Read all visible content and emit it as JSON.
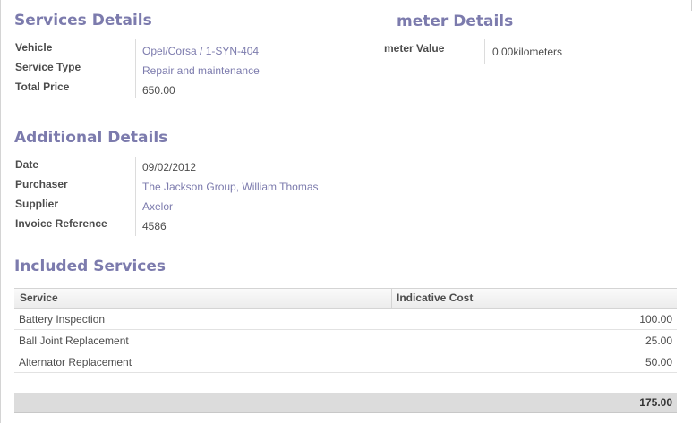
{
  "services_details": {
    "title": "Services Details",
    "fields": [
      {
        "label": "Vehicle",
        "value": "Opel/Corsa / 1-SYN-404"
      },
      {
        "label": "Service Type",
        "value": "Repair and maintenance"
      },
      {
        "label": "Total Price",
        "value": "650.00"
      }
    ]
  },
  "meter_details": {
    "title": "meter Details",
    "label": "meter Value",
    "value": "0.00",
    "unit": "kilometers"
  },
  "additional_details": {
    "title": "Additional Details",
    "fields": [
      {
        "label": "Date",
        "value": "09/02/2012"
      },
      {
        "label": "Purchaser",
        "value": "The Jackson Group, William Thomas"
      },
      {
        "label": "Supplier",
        "value": "Axelor"
      },
      {
        "label": "Invoice Reference",
        "value": "4586"
      }
    ]
  },
  "included_services": {
    "title": "Included Services",
    "columns": [
      "Service",
      "Indicative Cost"
    ],
    "rows": [
      {
        "service": "Battery Inspection",
        "cost": "100.00"
      },
      {
        "service": "Ball Joint Replacement",
        "cost": "25.00"
      },
      {
        "service": "Alternator Replacement",
        "cost": "50.00"
      }
    ],
    "total": "175.00"
  }
}
